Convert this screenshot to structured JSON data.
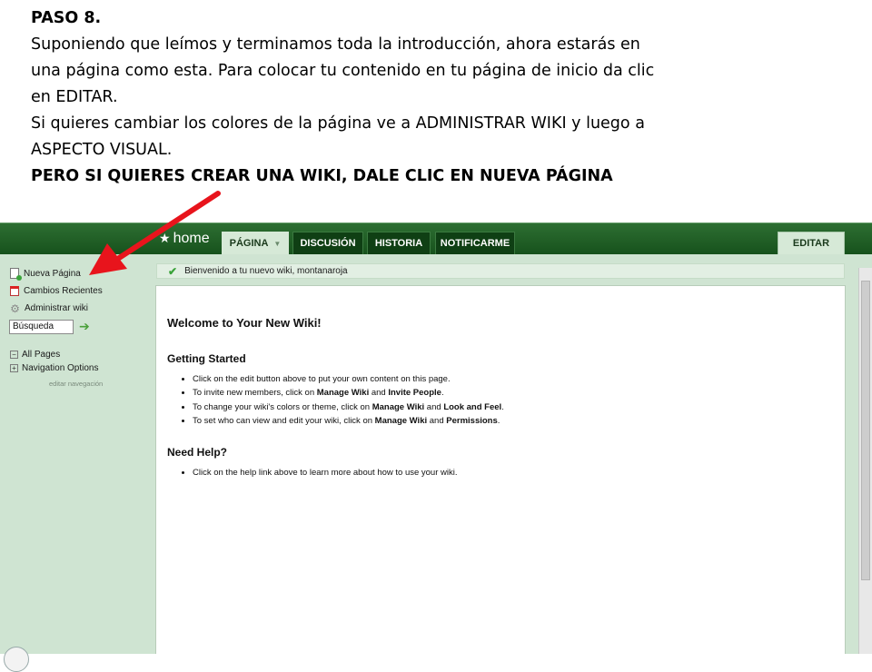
{
  "instructions": {
    "heading": "PASO 8.",
    "lines": [
      "Suponiendo que leímos y terminamos toda la introducción, ahora estarás en",
      "una página como esta. Para colocar tu contenido en tu página de inicio da clic",
      "en EDITAR.",
      "Si quieres cambiar los colores de la página ve a ADMINISTRAR WIKI y luego a",
      "ASPECTO VISUAL."
    ],
    "emphasis": "PERO SI QUIERES CREAR UNA WIKI, DALE CLIC EN NUEVA PÁGINA"
  },
  "topbar": {
    "brand": "home",
    "brand_icon": "star-icon",
    "tabs": [
      "PÁGINA",
      "DISCUSIÓN",
      "HISTORIA",
      "NOTIFICARME"
    ],
    "active_tab": "PÁGINA",
    "edit_label": "EDITAR"
  },
  "sidebar": {
    "items": [
      "Nueva Página",
      "Cambios Recientes",
      "Administrar wiki"
    ],
    "search_value": "Búsqueda",
    "tree": [
      "All Pages",
      "Navigation Options"
    ],
    "edit_nav_label": "editar navegación"
  },
  "notice": "Bienvenido a tu nuevo wiki, montanaroja",
  "content": {
    "title": "Welcome to Your New Wiki!",
    "getting_started": {
      "heading": "Getting Started",
      "items": [
        {
          "pre": "Click on the edit button above to put your own content on this page."
        },
        {
          "pre": "To invite new members, click on ",
          "b1": "Manage Wiki",
          "mid": " and ",
          "b2": "Invite People",
          "post": "."
        },
        {
          "pre": "To change your wiki's colors or theme, click on ",
          "b1": "Manage Wiki",
          "mid": " and ",
          "b2": "Look and Feel",
          "post": "."
        },
        {
          "pre": "To set who can view and edit your wiki, click on ",
          "b1": "Manage Wiki",
          "mid": " and ",
          "b2": "Permissions",
          "post": "."
        }
      ]
    },
    "need_help": {
      "heading": "Need Help?",
      "items": [
        "Click on the help link above to learn more about how to use your wiki."
      ]
    }
  },
  "colors": {
    "topbar": "#17521c",
    "sidebar_bg": "#cfe4d2",
    "arrow": "#e8141c"
  }
}
